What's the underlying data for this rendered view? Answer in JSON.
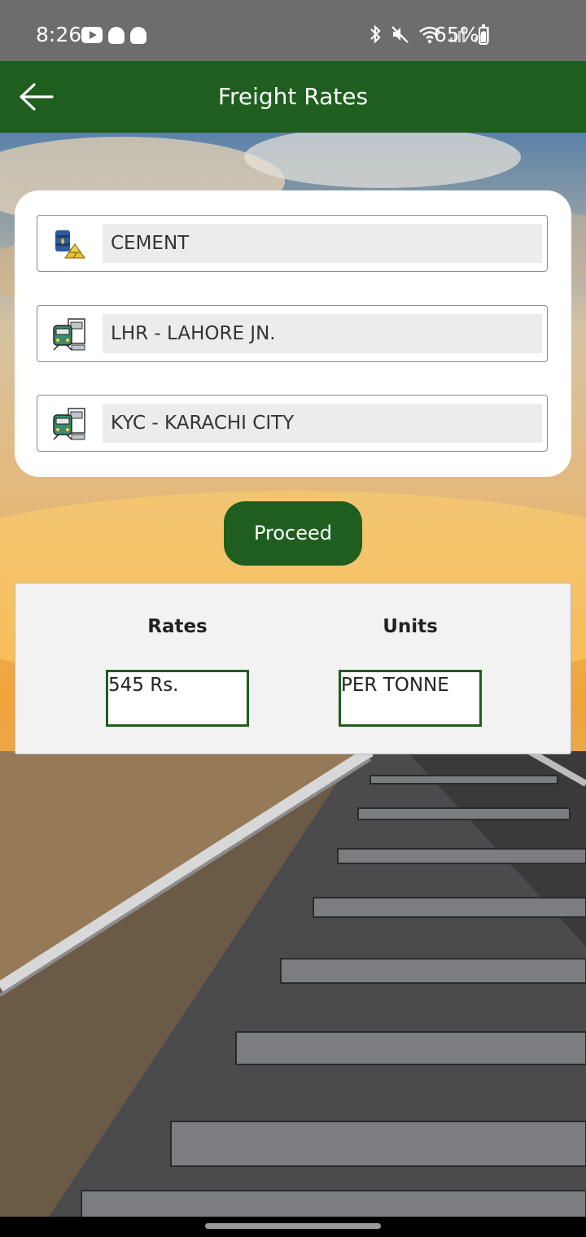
{
  "status_bar": {
    "time": "8:26",
    "battery": "65%"
  },
  "app_bar": {
    "title": "Freight Rates"
  },
  "form": {
    "commodity": {
      "value": "CEMENT",
      "icon": "cement-barrel-icon"
    },
    "from_station": {
      "value": "LHR - LAHORE JN.",
      "icon": "train-station-icon"
    },
    "to_station": {
      "value": "KYC - KARACHI CITY",
      "icon": "train-station-icon"
    }
  },
  "actions": {
    "proceed_label": "Proceed"
  },
  "results": {
    "rates_header": "Rates",
    "units_header": "Units",
    "rate_value": "545 Rs.",
    "unit_value": "PER TONNE"
  },
  "colors": {
    "primary": "#1f5e1f",
    "status_bar": "#6d6d6d"
  }
}
